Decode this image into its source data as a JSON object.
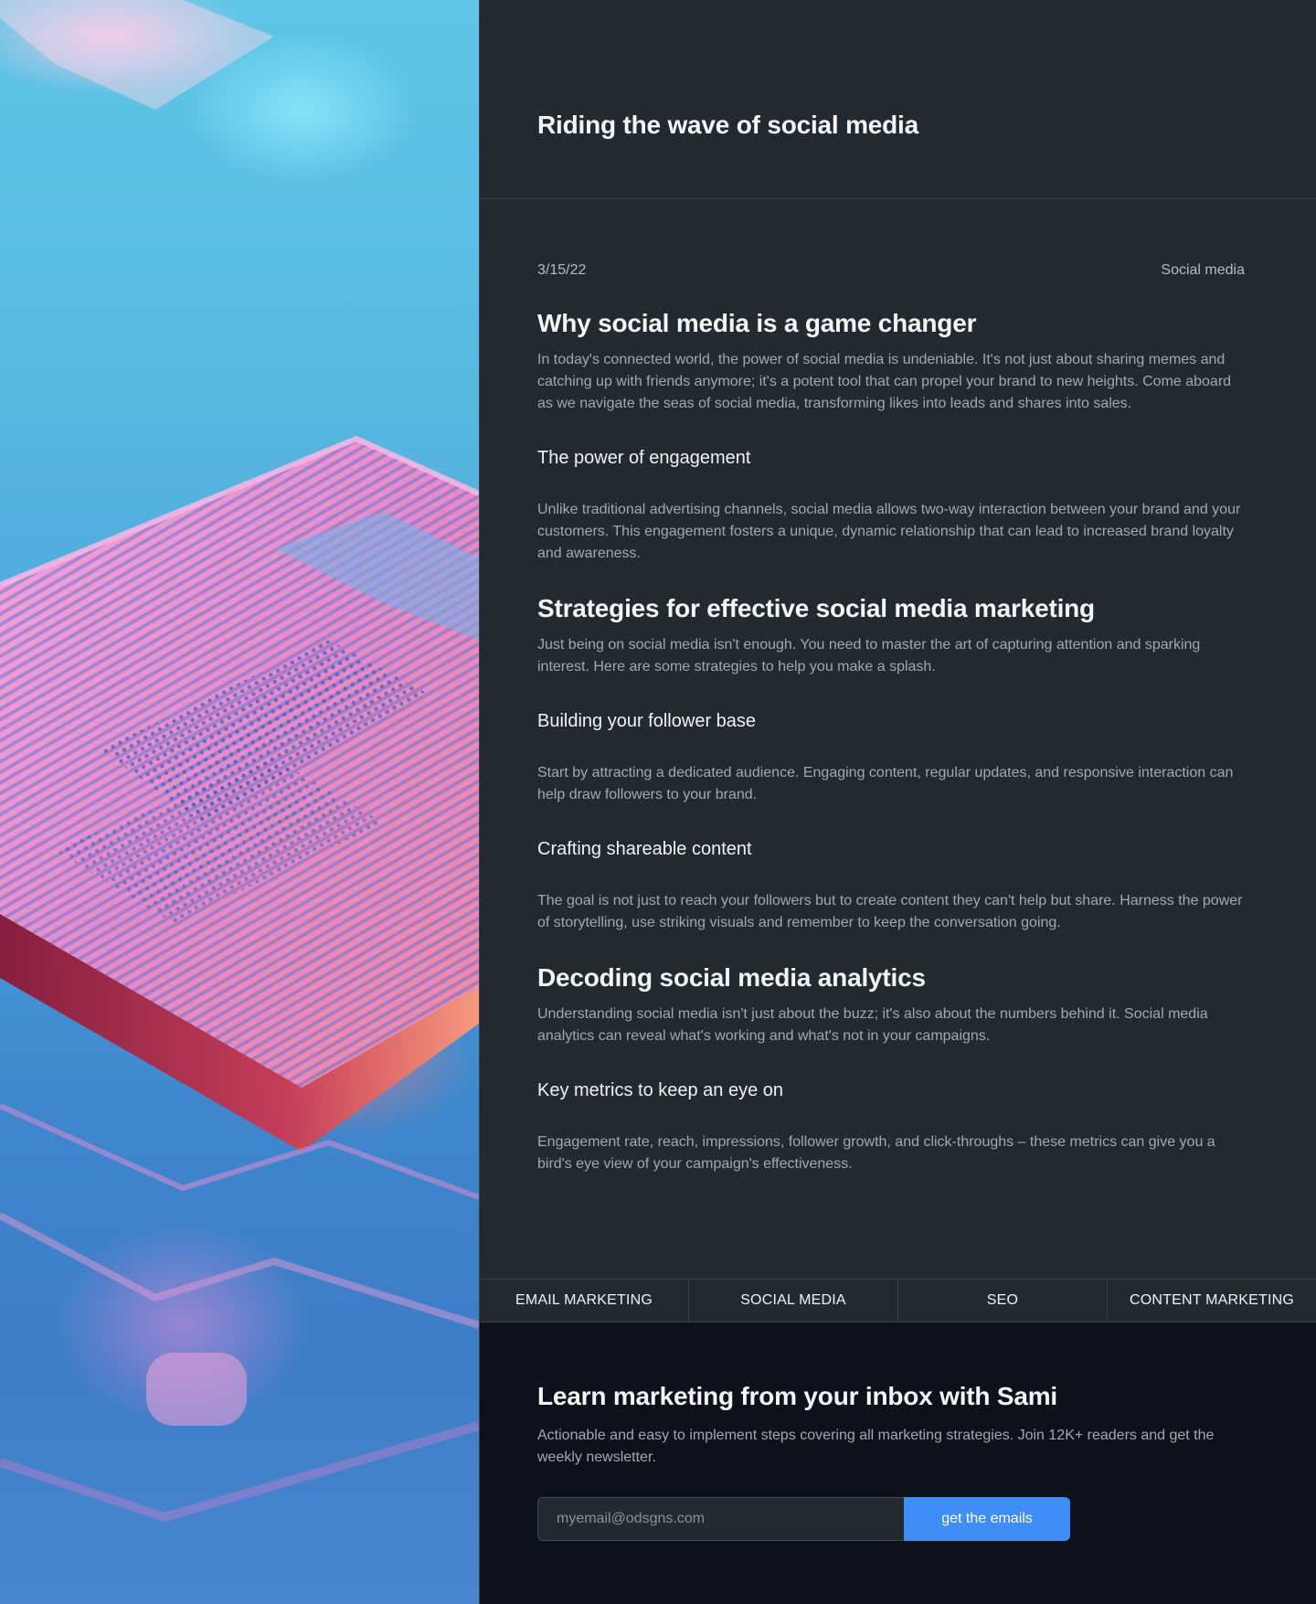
{
  "header": {
    "title": "Riding the wave of social media"
  },
  "article": {
    "date": "3/15/22",
    "category": "Social media",
    "sections": [
      {
        "heading": "Why social media is a game changer",
        "body": "In today's connected world, the power of social media is undeniable. It's not just about sharing memes and catching up with friends anymore; it's a potent tool that can propel your brand to new heights. Come aboard as we navigate the seas of social media, transforming likes into leads and shares into sales."
      },
      {
        "subheading": "The power of engagement",
        "body": "Unlike traditional advertising channels, social media allows two-way interaction between your brand and your customers. This engagement fosters a unique, dynamic relationship that can lead to increased brand loyalty and awareness."
      },
      {
        "heading": "Strategies for effective social media marketing",
        "body": "Just being on social media isn't enough. You need to master the art of capturing attention and sparking interest. Here are some strategies to help you make a splash."
      },
      {
        "subheading": "Building your follower base",
        "body": "Start by attracting a dedicated audience. Engaging content, regular updates, and responsive interaction can help draw followers to your brand."
      },
      {
        "subheading": "Crafting shareable content",
        "body": "The goal is not just to reach your followers but to create content they can't help but share. Harness the power of storytelling, use striking visuals and remember to keep the conversation going."
      },
      {
        "heading": "Decoding social media analytics",
        "body": "Understanding social media isn't just about the buzz; it's also about the numbers behind it. Social media analytics can reveal what's working and what's not in your campaigns."
      },
      {
        "subheading": "Key metrics to keep an eye on",
        "body": "Engagement rate, reach, impressions, follower growth, and click-throughs – these metrics can give you a bird's eye view of your campaign's effectiveness."
      }
    ]
  },
  "categories": [
    "EMAIL MARKETING",
    "SOCIAL MEDIA",
    "SEO",
    "CONTENT MARKETING"
  ],
  "newsletter": {
    "title": "Learn marketing from your inbox with Sami",
    "description": "Actionable and easy to implement steps covering all marketing strategies. Join 12K+ readers and get the weekly newsletter.",
    "email_placeholder": "myemail@odsgns.com",
    "button_label": "get the emails"
  },
  "colors": {
    "page_background": "#24292f",
    "newsletter_background": "#0e111a",
    "accent": "#3d8df5",
    "body_text": "#a3a9b2",
    "heading_text": "#f4f5f7"
  }
}
